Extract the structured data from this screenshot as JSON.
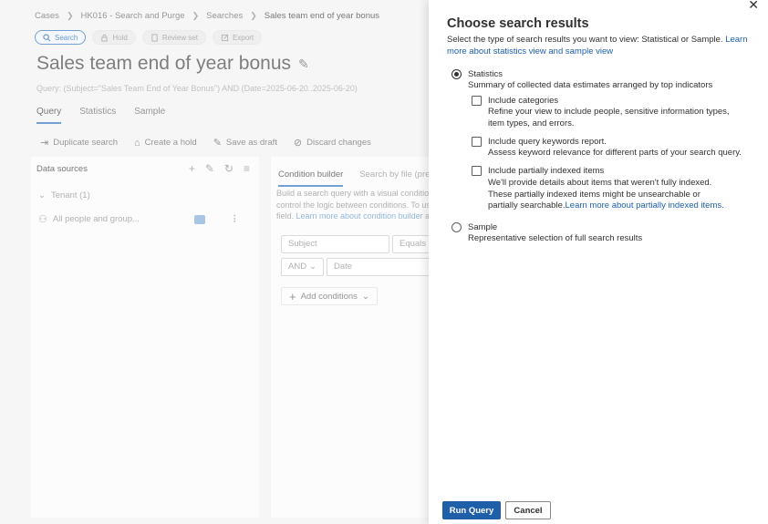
{
  "breadcrumb": {
    "items": [
      "Cases",
      "HK016 - Search and Purge",
      "Searches",
      "Sales team end of year bonus"
    ]
  },
  "actions": {
    "search": "Search",
    "hold": "Hold",
    "review_set": "Review set",
    "export": "Export"
  },
  "page": {
    "title": "Sales team end of year bonus",
    "query": "Query: (Subject=\"Sales Team End of Year Bonus\") AND (Date=2025-06-20..2025-06-20)"
  },
  "tabs": [
    "Query",
    "Statistics",
    "Sample"
  ],
  "toolbar": {
    "duplicate": "Duplicate search",
    "create_hold": "Create a hold",
    "save_draft": "Save as draft",
    "discard": "Discard changes"
  },
  "data_sources": {
    "heading": "Data sources",
    "tenant": "Tenant (1)",
    "source": "All people and group..."
  },
  "condition_builder": {
    "tabs": [
      "Condition builder",
      "Search by file (pre"
    ],
    "desc_1": "Build a search query with a visual condition",
    "desc_2": "control the logic between conditions. To use",
    "desc_3_prefix": "field. ",
    "desc_3_link": "Learn more about condition builder",
    "desc_3_suffix": " an",
    "subject_placeholder": "Subject",
    "operator": "Equals an",
    "logic": "AND",
    "date_placeholder": "Date",
    "add_conditions": "Add conditions"
  },
  "panel": {
    "title": "Choose search results",
    "desc": "Select the type of search results you want to view: Statistical or Sample. ",
    "desc_link": "Learn more about statistics view and sample view",
    "statistics": {
      "title": "Statistics",
      "desc": "Summary of collected data estimates arranged by top indicators"
    },
    "categories": {
      "title": "Include categories",
      "desc": "Refine your view to include people, sensitive information types, item types, and errors."
    },
    "keywords": {
      "title": "Include query keywords report.",
      "desc": "Assess keyword relevance for different parts of your search query."
    },
    "partially": {
      "title": "Include partially indexed items",
      "desc": "We'll provide details about items that weren't fully indexed. These partially indexed items might be unsearchable or partially searchable.",
      "link": "Learn more about partially indexed items."
    },
    "sample": {
      "title": "Sample",
      "desc": "Representative selection of full search results"
    },
    "run": "Run Query",
    "cancel": "Cancel"
  }
}
